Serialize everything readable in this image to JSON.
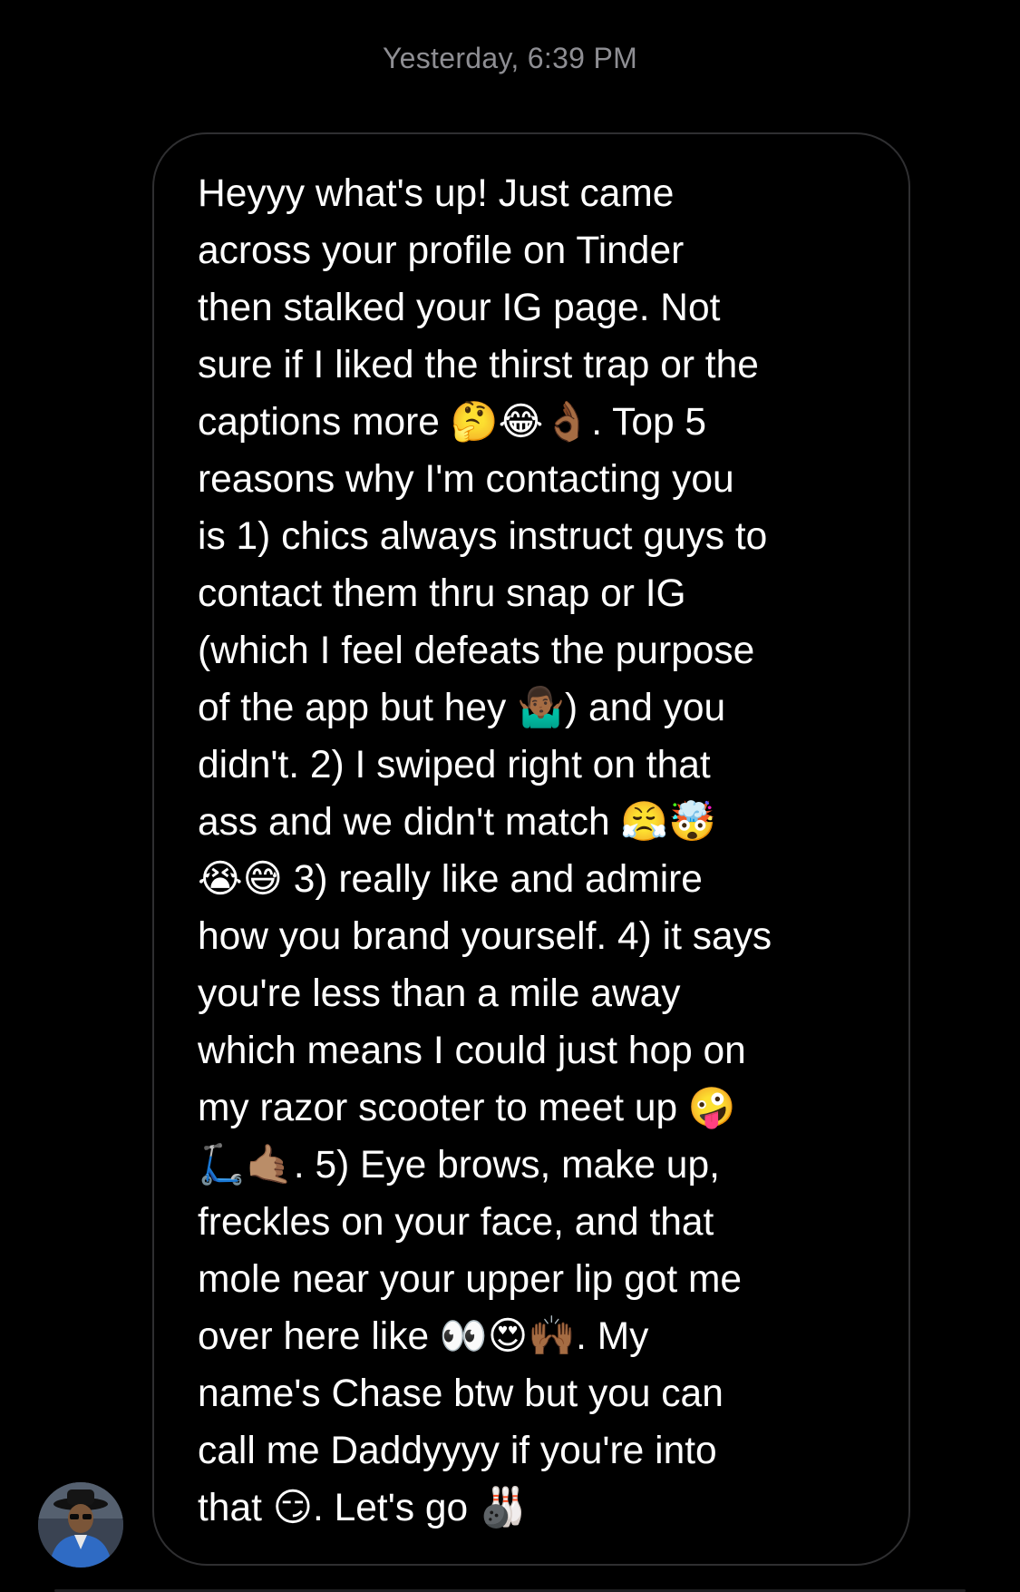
{
  "thread": {
    "timestamp": "Yesterday, 6:39 PM"
  },
  "message": {
    "text": "Heyyy what's up! Just came\nacross your profile on Tinder\nthen stalked your IG page. Not\nsure if I liked the thirst trap or the\ncaptions more 🤔😂👌🏾. Top 5\nreasons why I'm contacting you\nis 1) chics always instruct guys to\ncontact them thru snap or IG\n(which I feel defeats the purpose\nof the app but hey 🤷🏾‍♂️) and you\ndidn't. 2) I swiped right on that\nass and we didn't match 😤🤯\n😭😅 3) really like and admire\nhow you brand yourself. 4) it says\nyou're less than a mile away\nwhich means I could just hop on\nmy razor scooter to meet up 🤪\n🛴🤙🏽. 5) Eye brows, make up,\nfreckles on your face, and that\nmole near your upper lip got me\nover here like 👀😍🙌🏾. My\nname's Chase btw but you can\ncall me Daddyyyy if you're into\nthat 😏. Let's go 🎳"
  },
  "sender": {
    "avatar_icon": "profile-photo"
  },
  "colors": {
    "background": "#000000",
    "bubble_border": "#2f2f31",
    "timestamp": "#8e8e93",
    "text": "#ffffff"
  }
}
